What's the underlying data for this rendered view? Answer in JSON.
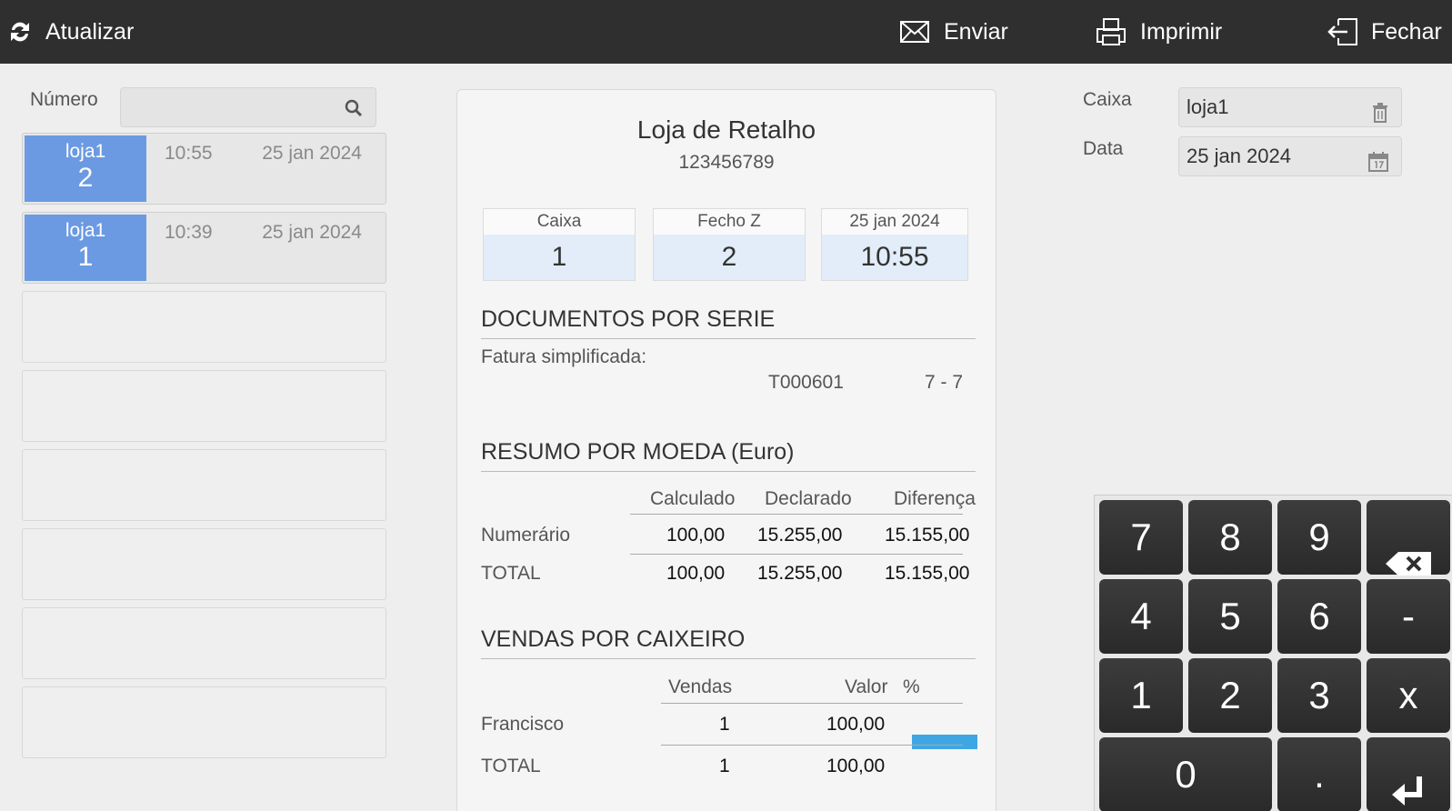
{
  "toolbar": {
    "refresh_label": "Atualizar",
    "send_label": "Enviar",
    "print_label": "Imprimir",
    "close_label": "Fechar"
  },
  "search": {
    "label": "Número",
    "placeholder": ""
  },
  "list": {
    "items": [
      {
        "store": "loja1",
        "number": "2",
        "time": "10:55",
        "date": "25 jan 2024"
      },
      {
        "store": "loja1",
        "number": "1",
        "time": "10:39",
        "date": "25 jan 2024"
      }
    ]
  },
  "report": {
    "title": "Loja de Retalho",
    "nif": "123456789",
    "kpis": {
      "caixa_label": "Caixa",
      "caixa_value": "1",
      "fecho_label": "Fecho Z",
      "fecho_value": "2",
      "date_label": "25 jan 2024",
      "time_value": "10:55"
    },
    "docs": {
      "title": "DOCUMENTOS POR SERIE",
      "type": "Fatura simplificada:",
      "series": "T000601",
      "range": "7 - 7"
    },
    "currency": {
      "title": "RESUMO POR MOEDA (Euro)",
      "col_calc": "Calculado",
      "col_decl": "Declarado",
      "col_diff": "Diferença",
      "row1_label": "Numerário",
      "row1_calc": "100,00",
      "row1_decl": "15.255,00",
      "row1_diff": "15.155,00",
      "total_label": "TOTAL",
      "total_calc": "100,00",
      "total_decl": "15.255,00",
      "total_diff": "15.155,00"
    },
    "cashier": {
      "title": "VENDAS POR CAIXEIRO",
      "col_sales": "Vendas",
      "col_value": "Valor",
      "col_pct": "%",
      "row1_name": "Francisco",
      "row1_sales": "1",
      "row1_value": "100,00",
      "row1_pct": 1.0,
      "total_label": "TOTAL",
      "total_sales": "1",
      "total_value": "100,00"
    }
  },
  "filters": {
    "caixa_label": "Caixa",
    "caixa_value": "loja1",
    "data_label": "Data",
    "data_value": "25 jan 2024"
  },
  "keypad": {
    "k7": "7",
    "k8": "8",
    "k9": "9",
    "k4": "4",
    "k5": "5",
    "k6": "6",
    "kminus": "-",
    "k1": "1",
    "k2": "2",
    "k3": "3",
    "kx": "x",
    "k0": "0",
    "kdot": "."
  },
  "colors": {
    "topbar": "#2f2f2f",
    "badge": "#6b9ae2",
    "kpi_bg": "#e2edf9",
    "bar": "#3ea6e2",
    "key": "#333333"
  }
}
